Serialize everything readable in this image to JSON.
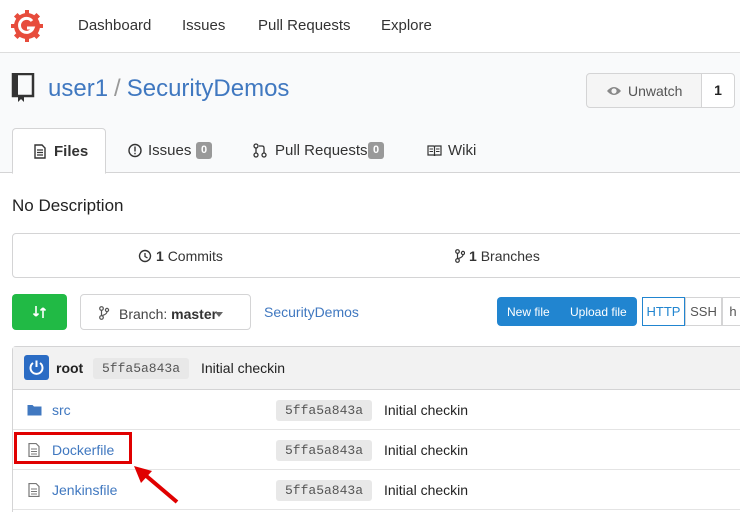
{
  "nav": {
    "items": [
      "Dashboard",
      "Issues",
      "Pull Requests",
      "Explore"
    ]
  },
  "repo": {
    "owner": "user1",
    "separator": "/",
    "name": "SecurityDemos"
  },
  "watch": {
    "label": "Unwatch",
    "count": "1"
  },
  "tabs": [
    {
      "label": "Files",
      "active": true
    },
    {
      "label": "Issues",
      "badge": "0"
    },
    {
      "label": "Pull Requests",
      "badge": "0"
    },
    {
      "label": "Wiki"
    }
  ],
  "description": "No Description",
  "stats": {
    "commits_count": "1",
    "commits_label": "Commits",
    "branches_count": "1",
    "branches_label": "Branches"
  },
  "branch": {
    "label": "Branch:",
    "value": "master"
  },
  "path": "SecurityDemos",
  "file_buttons": {
    "new_file": "New file",
    "upload_file": "Upload file"
  },
  "clone": {
    "http": "HTTP",
    "ssh": "SSH",
    "extra": "h"
  },
  "latest_commit": {
    "author": "root",
    "sha": "5ffa5a843a",
    "message": "Initial checkin"
  },
  "files": [
    {
      "name": "src",
      "type": "folder",
      "sha": "5ffa5a843a",
      "message": "Initial checkin"
    },
    {
      "name": "Dockerfile",
      "type": "file",
      "sha": "5ffa5a843a",
      "message": "Initial checkin"
    },
    {
      "name": "Jenkinsfile",
      "type": "file",
      "sha": "5ffa5a843a",
      "message": "Initial checkin"
    }
  ],
  "colors": {
    "link": "#4078c0",
    "green": "#21ba45",
    "blue": "#2185d0",
    "annotation": "#e00000"
  }
}
